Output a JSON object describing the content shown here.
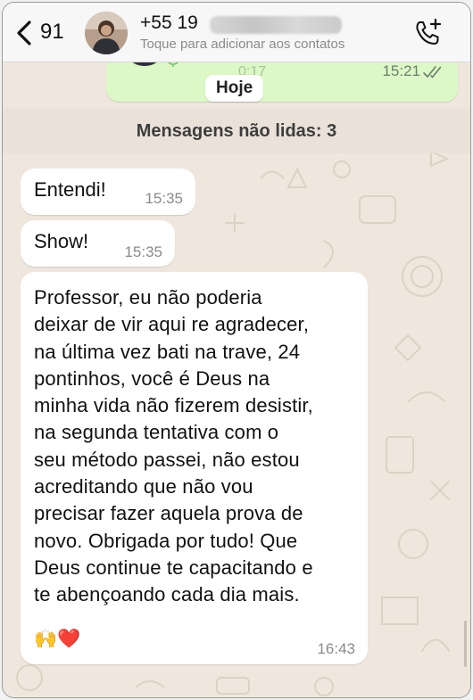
{
  "header": {
    "unread_count": "91",
    "contact_name": "+55 19",
    "subtitle": "Toque para adicionar aos contatos"
  },
  "previous_message": {
    "duration": "0:17",
    "time": "15:21"
  },
  "date_label": "Hoje",
  "unread_banner": "Mensagens não lidas: 3",
  "messages": [
    {
      "text": "Entendi!",
      "time": "15:35"
    },
    {
      "text": "Show!",
      "time": "15:35"
    },
    {
      "text": "Professor, eu não poderia\ndeixar de vir aqui re agradecer,\nna última vez bati na trave, 24\npontinhos, você é Deus na\nminha vida não fizerem desistir,\nna segunda tentativa com o\nseu método passei, não estou\nacreditando que não vou\nprecisar fazer aquela prova de\nnovo. Obrigada por tudo! Que\nDeus continue te capacitando e\nte abençoando cada dia mais.",
      "emojis": "🙌❤️",
      "time": "16:43"
    }
  ],
  "colors": {
    "chat_background": "#efe7dd",
    "outgoing_bubble": "#dcf8c6",
    "incoming_bubble": "#ffffff",
    "header_background": "#f7f7f7"
  },
  "icons": {
    "back": "chevron-left-icon",
    "call": "phone-add-icon",
    "mic": "microphone-icon",
    "read_receipt": "double-check-icon"
  }
}
